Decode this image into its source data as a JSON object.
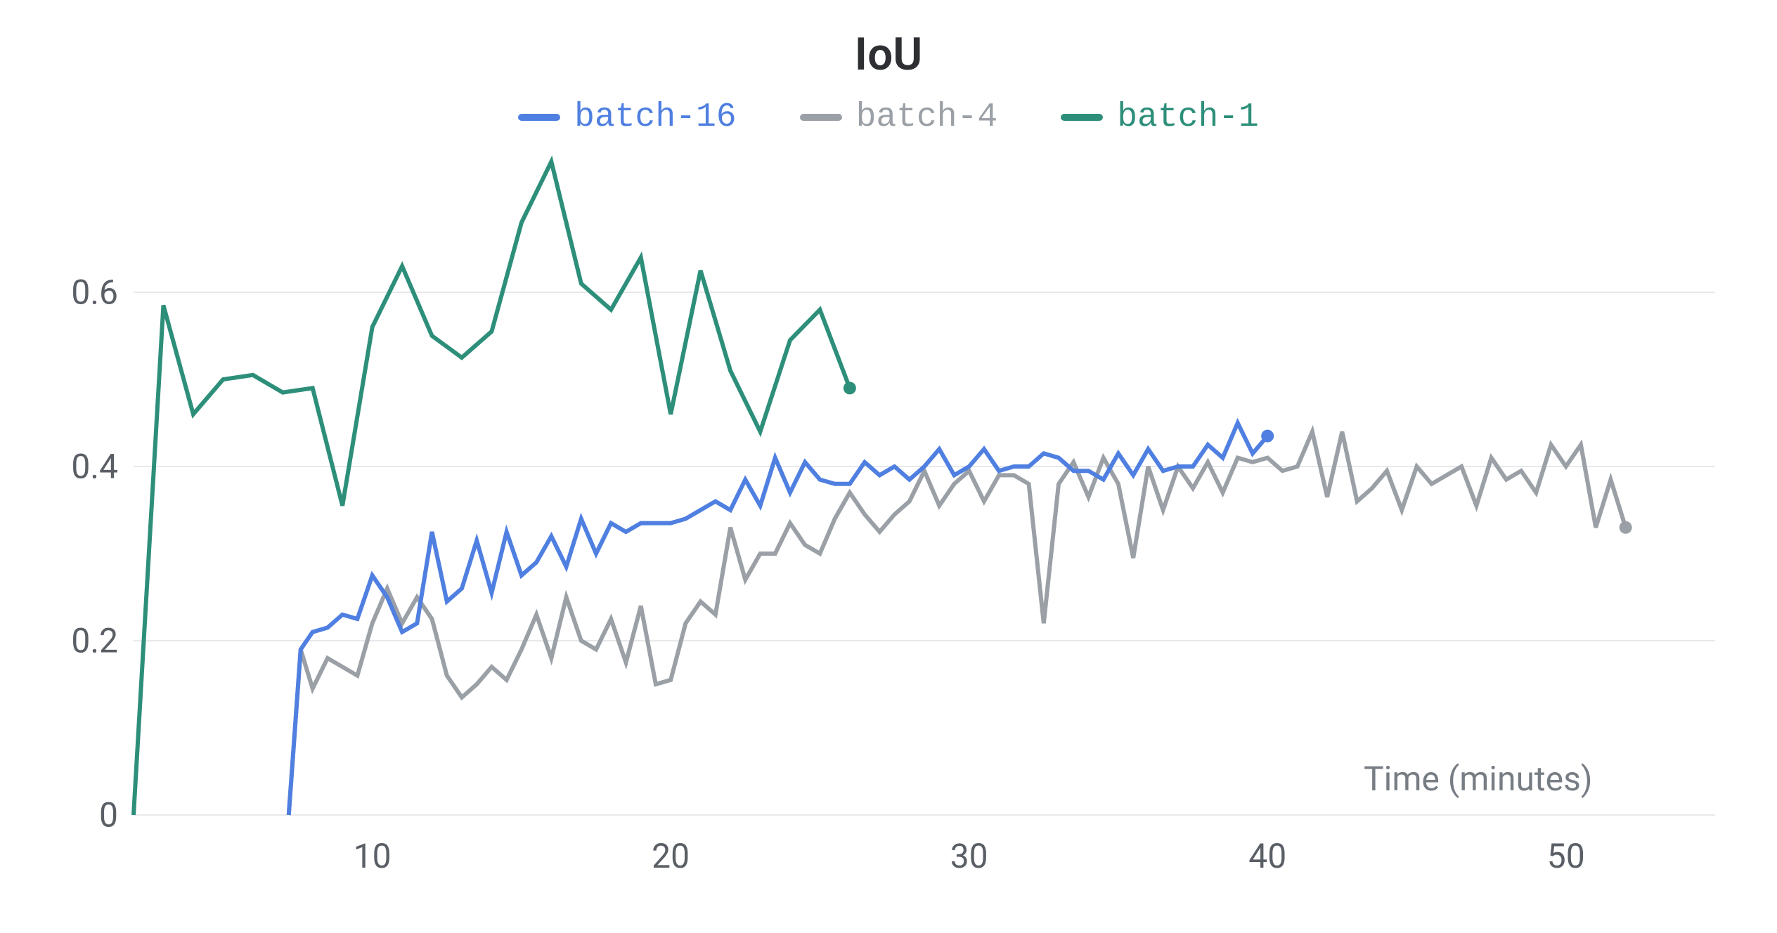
{
  "chart_data": {
    "type": "line",
    "title": "IoU",
    "xlabel": "Time (minutes)",
    "ylabel": "",
    "xlim": [
      2,
      55
    ],
    "ylim": [
      0,
      0.75
    ],
    "y_ticks": [
      0,
      0.2,
      0.4,
      0.6
    ],
    "x_ticks": [
      10,
      20,
      30,
      40,
      50
    ],
    "series": [
      {
        "name": "batch-16",
        "color": "#4f7fe0",
        "x": [
          7.2,
          7.6,
          8.0,
          8.5,
          9.0,
          9.5,
          10.0,
          10.5,
          11.0,
          11.5,
          12.0,
          12.5,
          13.0,
          13.5,
          14.0,
          14.5,
          15.0,
          15.5,
          16.0,
          16.5,
          17.0,
          17.5,
          18.0,
          18.5,
          19.0,
          19.5,
          20.0,
          20.5,
          21.0,
          21.5,
          22.0,
          22.5,
          23.0,
          23.5,
          24.0,
          24.5,
          25.0,
          25.5,
          26.0,
          26.5,
          27.0,
          27.5,
          28.0,
          28.5,
          29.0,
          29.5,
          30.0,
          30.5,
          31.0,
          31.5,
          32.0,
          32.5,
          33.0,
          33.5,
          34.0,
          34.5,
          35.0,
          35.5,
          36.0,
          36.5,
          37.0,
          37.5,
          38.0,
          38.5,
          39.0,
          39.5,
          40.0
        ],
        "y": [
          0.0,
          0.19,
          0.21,
          0.215,
          0.23,
          0.225,
          0.275,
          0.25,
          0.21,
          0.22,
          0.325,
          0.245,
          0.26,
          0.315,
          0.255,
          0.325,
          0.275,
          0.29,
          0.32,
          0.285,
          0.34,
          0.3,
          0.335,
          0.325,
          0.335,
          0.335,
          0.335,
          0.34,
          0.35,
          0.36,
          0.35,
          0.385,
          0.355,
          0.41,
          0.37,
          0.405,
          0.385,
          0.38,
          0.38,
          0.405,
          0.39,
          0.4,
          0.385,
          0.4,
          0.42,
          0.39,
          0.4,
          0.42,
          0.395,
          0.4,
          0.4,
          0.415,
          0.41,
          0.395,
          0.395,
          0.385,
          0.415,
          0.39,
          0.42,
          0.395,
          0.4,
          0.4,
          0.425,
          0.41,
          0.45,
          0.415,
          0.435
        ],
        "end_marker": true
      },
      {
        "name": "batch-4",
        "color": "#9aa0a6",
        "x": [
          7.2,
          7.6,
          8.0,
          8.5,
          9.0,
          9.5,
          10.0,
          10.5,
          11.0,
          11.5,
          12.0,
          12.5,
          13.0,
          13.5,
          14.0,
          14.5,
          15.0,
          15.5,
          16.0,
          16.5,
          17.0,
          17.5,
          18.0,
          18.5,
          19.0,
          19.5,
          20.0,
          20.5,
          21.0,
          21.5,
          22.0,
          22.5,
          23.0,
          23.5,
          24.0,
          24.5,
          25.0,
          25.5,
          26.0,
          26.5,
          27.0,
          27.5,
          28.0,
          28.5,
          29.0,
          29.5,
          30.0,
          30.5,
          31.0,
          31.5,
          32.0,
          32.5,
          33.0,
          33.5,
          34.0,
          34.5,
          35.0,
          35.5,
          36.0,
          36.5,
          37.0,
          37.5,
          38.0,
          38.5,
          39.0,
          39.5,
          40.0,
          40.5,
          41.0,
          41.5,
          42.0,
          42.5,
          43.0,
          43.5,
          44.0,
          44.5,
          45.0,
          45.5,
          46.0,
          46.5,
          47.0,
          47.5,
          48.0,
          48.5,
          49.0,
          49.5,
          50.0,
          50.5,
          51.0,
          51.5,
          52.0
        ],
        "y": [
          0.0,
          0.19,
          0.145,
          0.18,
          0.17,
          0.16,
          0.22,
          0.26,
          0.22,
          0.25,
          0.225,
          0.16,
          0.135,
          0.15,
          0.17,
          0.155,
          0.19,
          0.23,
          0.18,
          0.25,
          0.2,
          0.19,
          0.225,
          0.175,
          0.24,
          0.15,
          0.155,
          0.22,
          0.245,
          0.23,
          0.33,
          0.27,
          0.3,
          0.3,
          0.335,
          0.31,
          0.3,
          0.34,
          0.37,
          0.345,
          0.325,
          0.345,
          0.36,
          0.395,
          0.355,
          0.38,
          0.395,
          0.36,
          0.39,
          0.39,
          0.38,
          0.22,
          0.38,
          0.405,
          0.365,
          0.41,
          0.38,
          0.295,
          0.4,
          0.35,
          0.4,
          0.375,
          0.405,
          0.37,
          0.41,
          0.405,
          0.41,
          0.395,
          0.4,
          0.44,
          0.365,
          0.44,
          0.36,
          0.375,
          0.395,
          0.35,
          0.4,
          0.38,
          0.39,
          0.4,
          0.355,
          0.41,
          0.385,
          0.395,
          0.37,
          0.425,
          0.4,
          0.425,
          0.33,
          0.385,
          0.33
        ],
        "end_marker": true
      },
      {
        "name": "batch-1",
        "color": "#2d8f7a",
        "x": [
          2.0,
          3.0,
          4.0,
          5.0,
          6.0,
          7.0,
          8.0,
          9.0,
          10.0,
          11.0,
          12.0,
          13.0,
          14.0,
          15.0,
          16.0,
          17.0,
          18.0,
          19.0,
          20.0,
          21.0,
          22.0,
          23.0,
          24.0,
          25.0,
          26.0
        ],
        "y": [
          0.0,
          0.585,
          0.46,
          0.5,
          0.505,
          0.485,
          0.49,
          0.355,
          0.56,
          0.63,
          0.55,
          0.525,
          0.555,
          0.68,
          0.75,
          0.61,
          0.58,
          0.64,
          0.46,
          0.625,
          0.51,
          0.44,
          0.545,
          0.58,
          0.49
        ],
        "end_marker": true
      }
    ]
  }
}
